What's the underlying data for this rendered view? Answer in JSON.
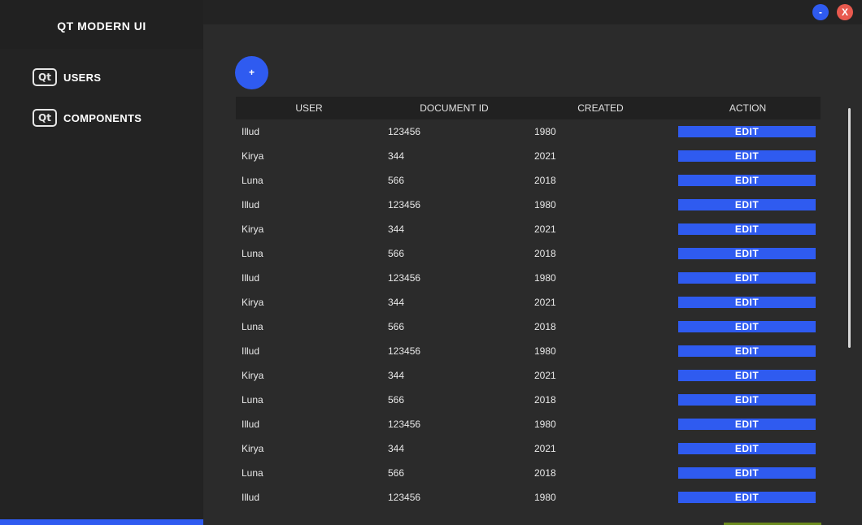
{
  "app": {
    "title": "QT MODERN UI"
  },
  "window_controls": {
    "minimize_label": "-",
    "close_label": "X"
  },
  "sidebar": {
    "items": [
      {
        "icon": "qt-logo-icon",
        "icon_text": "Qt",
        "label": "USERS"
      },
      {
        "icon": "qt-logo-icon",
        "icon_text": "Qt",
        "label": "COMPONENTS"
      }
    ]
  },
  "toolbar": {
    "add_label": "+"
  },
  "table": {
    "headers": {
      "user": "USER",
      "document_id": "DOCUMENT ID",
      "created": "CREATED",
      "action": "ACTION"
    },
    "rows": [
      {
        "user": "Illud",
        "document_id": "123456",
        "created": "1980",
        "action": "EDIT"
      },
      {
        "user": "Kirya",
        "document_id": "344",
        "created": "2021",
        "action": "EDIT"
      },
      {
        "user": "Luna",
        "document_id": "566",
        "created": "2018",
        "action": "EDIT"
      },
      {
        "user": "Illud",
        "document_id": "123456",
        "created": "1980",
        "action": "EDIT"
      },
      {
        "user": "Kirya",
        "document_id": "344",
        "created": "2021",
        "action": "EDIT"
      },
      {
        "user": "Luna",
        "document_id": "566",
        "created": "2018",
        "action": "EDIT"
      },
      {
        "user": "Illud",
        "document_id": "123456",
        "created": "1980",
        "action": "EDIT"
      },
      {
        "user": "Kirya",
        "document_id": "344",
        "created": "2021",
        "action": "EDIT"
      },
      {
        "user": "Luna",
        "document_id": "566",
        "created": "2018",
        "action": "EDIT"
      },
      {
        "user": "Illud",
        "document_id": "123456",
        "created": "1980",
        "action": "EDIT"
      },
      {
        "user": "Kirya",
        "document_id": "344",
        "created": "2021",
        "action": "EDIT"
      },
      {
        "user": "Luna",
        "document_id": "566",
        "created": "2018",
        "action": "EDIT"
      },
      {
        "user": "Illud",
        "document_id": "123456",
        "created": "1980",
        "action": "EDIT"
      },
      {
        "user": "Kirya",
        "document_id": "344",
        "created": "2021",
        "action": "EDIT"
      },
      {
        "user": "Luna",
        "document_id": "566",
        "created": "2018",
        "action": "EDIT"
      },
      {
        "user": "Illud",
        "document_id": "123456",
        "created": "1980",
        "action": "EDIT"
      }
    ]
  },
  "colors": {
    "accent": "#2f5bf0",
    "close": "#e8594e",
    "background": "#2b2b2b",
    "sidebar": "#232323"
  }
}
